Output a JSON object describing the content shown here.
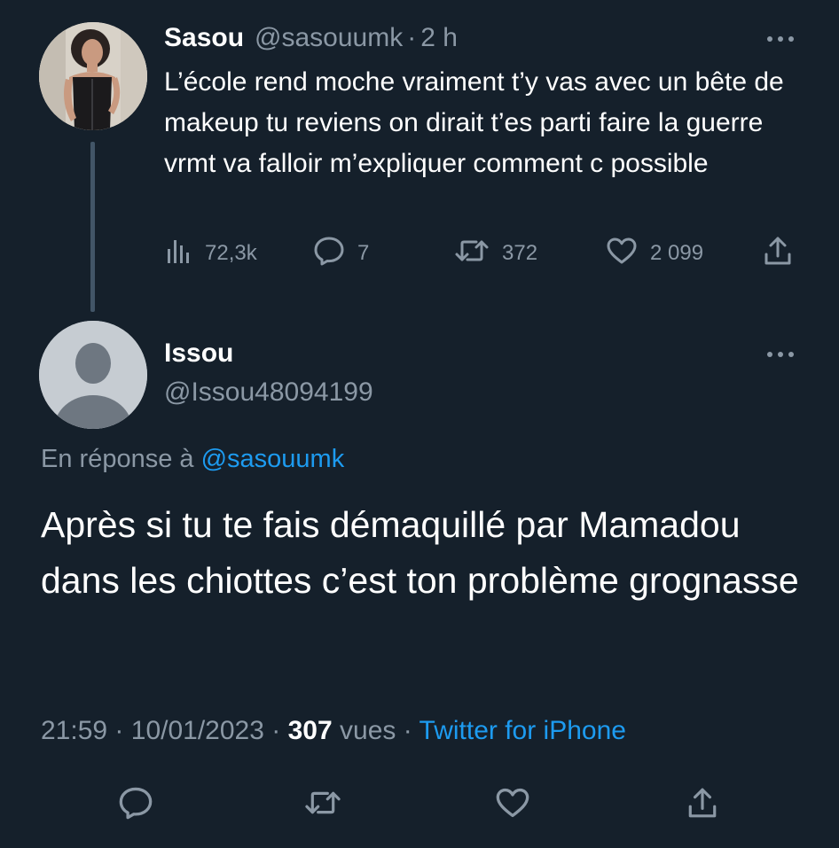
{
  "parent_tweet": {
    "name": "Sasou",
    "handle": "@sasouumk",
    "separator": "·",
    "time": "2 h",
    "text": "L’école rend moche vraiment t’y vas avec un bête de makeup tu reviens on dirait t’es parti faire la guerre vrmt va falloir m’expliquer comment c possible",
    "views": "72,3k",
    "replies": "7",
    "retweets": "372",
    "likes": "2 099"
  },
  "reply_tweet": {
    "name": "Issou",
    "handle": "@Issou48094199",
    "replying_prefix": "En réponse à",
    "replying_to": "@sasouumk",
    "text": "Après si tu te fais démaquillé par Mamadou dans les chiottes c’est ton problème grognasse",
    "time": "21:59",
    "date": "10/01/2023",
    "separator": "·",
    "views_count": "307",
    "views_label": "vues",
    "source": "Twitter for iPhone"
  },
  "colors": {
    "background": "#15202b",
    "primary_text": "#ffffff",
    "secondary_text": "#8b98a5",
    "link": "#1d9bf0",
    "thread_line": "#425567"
  },
  "icons": {
    "more": "more-horizontal-icon",
    "views": "bar-chart-icon",
    "reply": "speech-bubble-icon",
    "retweet": "retweet-arrows-icon",
    "like": "heart-icon",
    "share": "share-upload-icon"
  }
}
